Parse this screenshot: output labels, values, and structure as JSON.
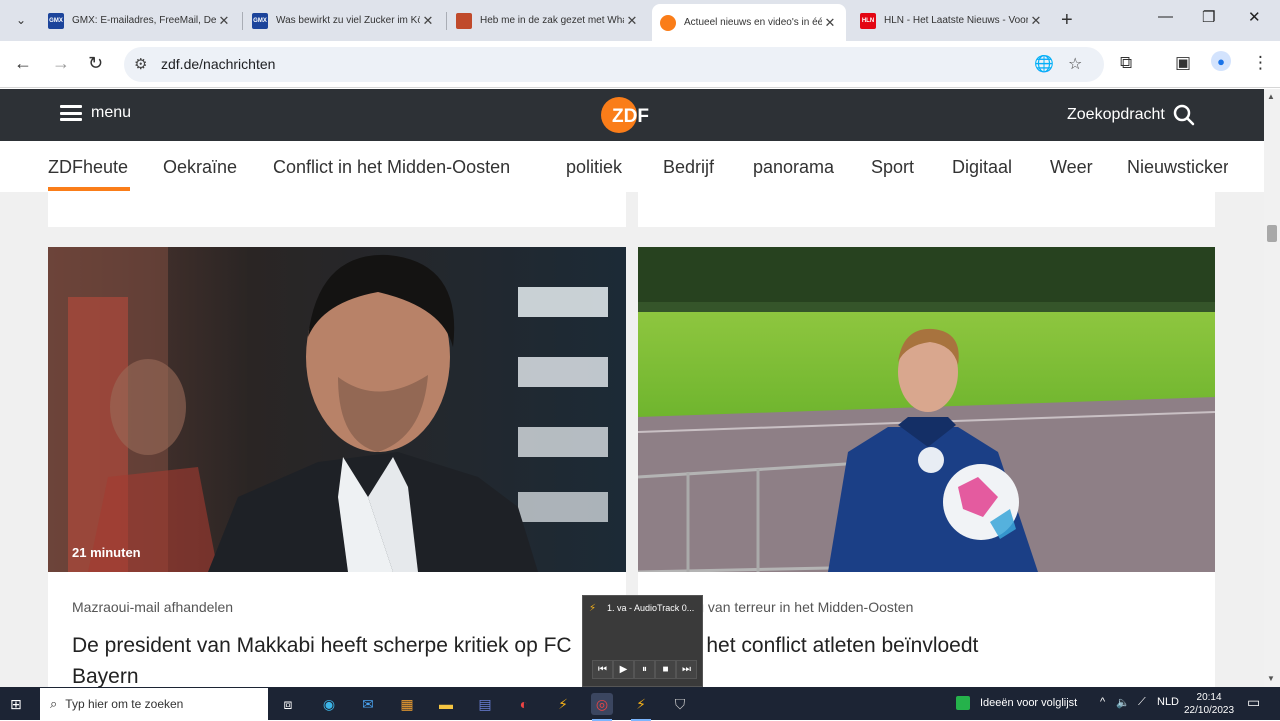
{
  "browser": {
    "tabs": [
      {
        "label": "GMX: E-mailadres, FreeMail, De-Mail & Nachrichten",
        "favicon_text": "GMX",
        "favicon_color": "#1c449b"
      },
      {
        "label": "Was bewirkt zu viel Zucker im Körper?",
        "favicon_text": "GMX",
        "favicon_color": "#1c449b"
      },
      {
        "label": "Heb me in de zak gezet met WhatsApp",
        "favicon_text": "",
        "favicon_color": "#c04a2b"
      },
      {
        "label": "Actueel nieuws en video's in één oogopslag",
        "favicon_text": "",
        "favicon_color": "#fa7d19"
      },
      {
        "label": "HLN - Het Laatste Nieuws - Voor het",
        "favicon_text": "HLN",
        "favicon_color": "#e30613"
      }
    ],
    "new_tab_symbol": "+",
    "address": "zdf.de/nachrichten"
  },
  "zdf": {
    "menu_label": "menu",
    "logo_text": "ZDF",
    "search_label": "Zoekopdracht",
    "accent_color": "#fa7d19",
    "categories": [
      "ZDFheute",
      "Oekraïne",
      "Conflict in het Midden-Oosten",
      "politiek",
      "Bedrijf",
      "panorama",
      "Sport",
      "Digitaal",
      "Weer",
      "Nieuwsticker"
    ]
  },
  "articles": [
    {
      "duration": "21 minuten",
      "kicker": "Mazraoui-mail afhandelen",
      "headline": "De president van Makkabi heeft scherpe kritiek op FC Bayern"
    },
    {
      "duration": "",
      "kicker": "Oorlog van terreur in het Midden-Oosten",
      "headline": "Hoe het conflict atleten beïnvloedt"
    }
  ],
  "media_popup": {
    "title": "1. va - AudioTrack 0...",
    "controls": [
      "previous",
      "play",
      "pause",
      "stop",
      "next"
    ]
  },
  "taskbar": {
    "search_placeholder": "Typ hier om te zoeken",
    "ideas_label": "Ideeën voor volglijst",
    "language": "NLD",
    "time": "20:14",
    "date": "22/10/2023"
  }
}
